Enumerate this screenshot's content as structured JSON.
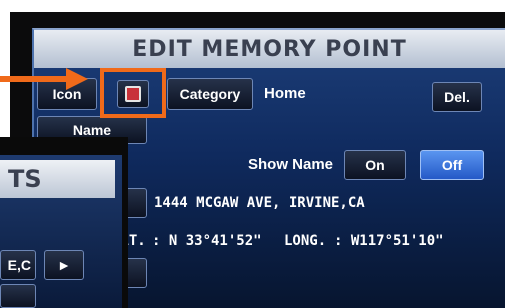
{
  "screen": {
    "title": "EDIT MEMORY POINT",
    "icon_label": "Icon",
    "category_label": "Category",
    "category_value": "Home",
    "delete_label": "Del.",
    "name_label": "Name",
    "show_name_label": "Show Name",
    "on_label": "On",
    "off_label": "Off",
    "address": "1444 MCGAW AVE, IRVINE,CA",
    "lat_label": "LAT.",
    "lat_value": ": N 33°41'52\"",
    "long_label": "LONG.",
    "long_value": ": W117°51'10\""
  },
  "overlay": {
    "title_fragment": "TS",
    "address_fragment": "E,C",
    "play_icon": "►"
  },
  "colors": {
    "highlight": "#f06a1a",
    "off_active": "#3d7be0",
    "screen_bg": "#0f2a5e"
  }
}
